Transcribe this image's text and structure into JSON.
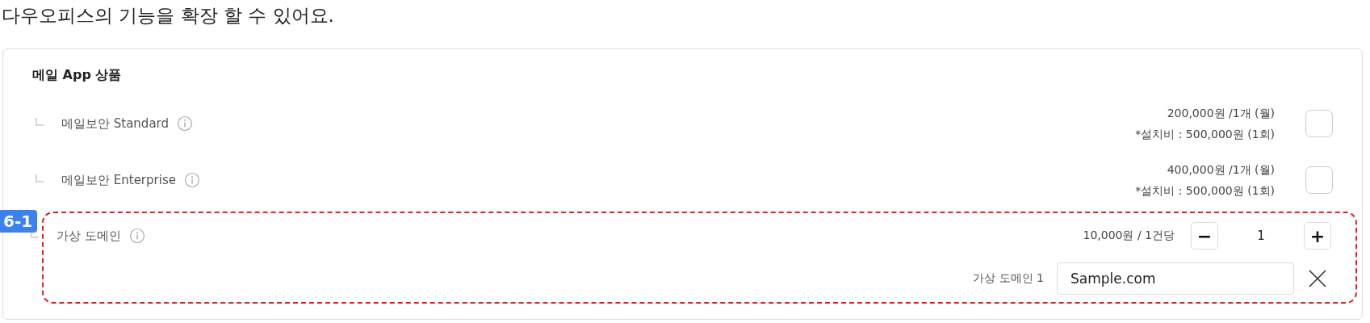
{
  "heading": "다우오피스의 기능을 확장 할 수 있어요.",
  "card": {
    "title": "메일 App 상품",
    "items": [
      {
        "kind": "checkbox",
        "name": "메일보안 Standard",
        "price": "200,000원 /1개 (월)",
        "fee": "*설치비 : 500,000원 (1회)",
        "checked": false
      },
      {
        "kind": "checkbox",
        "name": "메일보안 Enterprise",
        "price": "400,000원 /1개 (월)",
        "fee": "*설치비 : 500,000원 (1회)",
        "checked": false
      },
      {
        "kind": "stepper",
        "name": "가상 도메인",
        "price": "10,000원 / 1건당",
        "minus": "−",
        "count": "1",
        "plus": "+",
        "annotation": "6-1",
        "fields": [
          {
            "label": "가상 도메인 1",
            "value": "Sample.com"
          }
        ]
      }
    ]
  }
}
